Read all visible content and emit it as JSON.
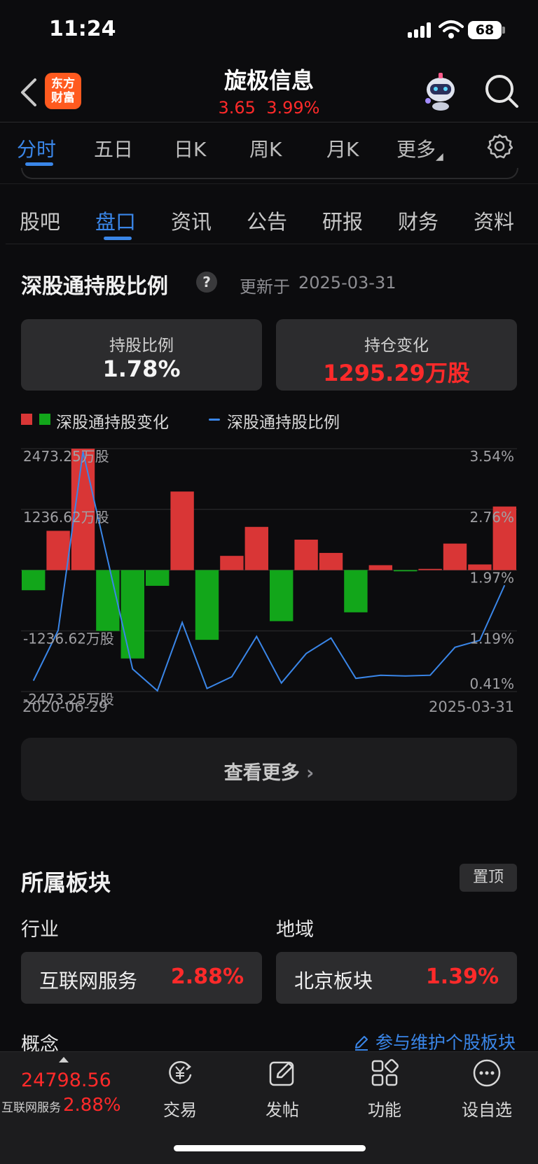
{
  "status_bar": {
    "time": "11:24",
    "battery": "68"
  },
  "header": {
    "logo_line1": "东方",
    "logo_line2": "财富",
    "title": "旋极信息",
    "price": "3.65",
    "change_pct": "3.99%"
  },
  "chart_tabs": [
    "分时",
    "五日",
    "日K",
    "周K",
    "月K",
    "更多"
  ],
  "section_tabs": [
    "股吧",
    "盘口",
    "资讯",
    "公告",
    "研报",
    "财务",
    "资料"
  ],
  "holdings": {
    "title": "深股通持股比例",
    "help": "?",
    "updated_label": "更新于",
    "updated_date": "2025-03-31",
    "ratio_label": "持股比例",
    "ratio_value": "1.78%",
    "change_label": "持仓变化",
    "change_value": "1295.29万股"
  },
  "legend": {
    "bars": "深股通持股变化",
    "line": "深股通持股比例"
  },
  "chart_data": {
    "type": "bar",
    "x_start": "2020-06-29",
    "x_end": "2025-03-31",
    "left_axis_labels": [
      "2473.25万股",
      "1236.62万股",
      "-1236.62万股",
      "-2473.25万股"
    ],
    "right_axis_labels": [
      "3.54%",
      "2.76%",
      "1.97%",
      "1.19%",
      "0.41%"
    ],
    "ylim_left": [
      -2473.25,
      2473.25
    ],
    "ylim_right": [
      0.41,
      3.54
    ],
    "series": [
      {
        "name": "深股通持股变化",
        "unit": "万股",
        "values": [
          -410,
          800,
          2473,
          -1240,
          -1800,
          -320,
          1600,
          -1420,
          290,
          880,
          -1040,
          620,
          350,
          -860,
          100,
          -25,
          25,
          540,
          115,
          1295
        ]
      },
      {
        "name": "深股通持股比例",
        "unit": "%",
        "values": [
          0.55,
          1.2,
          3.5,
          2.1,
          0.7,
          0.42,
          1.3,
          0.45,
          0.6,
          1.12,
          0.52,
          0.9,
          1.1,
          0.58,
          0.62,
          0.61,
          0.62,
          0.98,
          1.07,
          1.78
        ]
      }
    ],
    "colors": {
      "up": "#d93636",
      "down": "#12a61a",
      "line": "#3a86e8",
      "grid": "#2e2e30"
    }
  },
  "more_button": "查看更多",
  "sectors": {
    "title": "所属板块",
    "pin_label": "置顶",
    "industry_label": "行业",
    "region_label": "地域",
    "industry_name": "互联网服务",
    "industry_pct": "2.88%",
    "region_name": "北京板块",
    "region_pct": "1.39%",
    "concept_label": "概念",
    "maintain_link": "参与维护个股板块"
  },
  "bottom_bar": {
    "index_value": "24798.56",
    "index_name": "互联网服务",
    "index_pct": "2.88%",
    "nav": [
      "交易",
      "发帖",
      "功能",
      "设自选"
    ]
  }
}
